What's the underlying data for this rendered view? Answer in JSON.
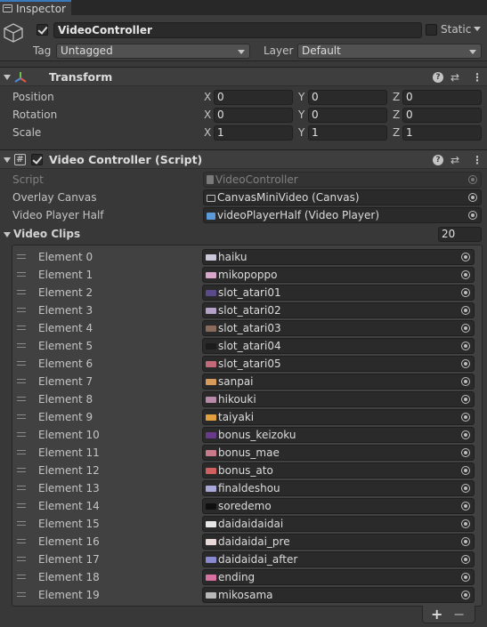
{
  "tab": {
    "label": "Inspector"
  },
  "gameobject": {
    "active": true,
    "name": "VideoController",
    "static_label": "Static",
    "tag_label": "Tag",
    "tag_value": "Untagged",
    "layer_label": "Layer",
    "layer_value": "Default"
  },
  "transform": {
    "title": "Transform",
    "rows": [
      {
        "label": "Position",
        "x": "0",
        "y": "0",
        "z": "0"
      },
      {
        "label": "Rotation",
        "x": "0",
        "y": "0",
        "z": "0"
      },
      {
        "label": "Scale",
        "x": "1",
        "y": "1",
        "z": "1"
      }
    ],
    "axis": {
      "x": "X",
      "y": "Y",
      "z": "Z"
    }
  },
  "script_component": {
    "title": "Video Controller (Script)",
    "script_label": "Script",
    "script_value": "VideoController",
    "overlay_label": "Overlay Canvas",
    "overlay_value": "CanvasMiniVideo (Canvas)",
    "player_label": "Video Player Half",
    "player_value": "videoPlayerHalf (Video Player)",
    "clips_label": "Video Clips",
    "clips_count": "20"
  },
  "clips": [
    {
      "label": "Element 0",
      "value": "haiku",
      "thumb": "#c9c9d9"
    },
    {
      "label": "Element 1",
      "value": "mikopoppo",
      "thumb": "#d7a6c9"
    },
    {
      "label": "Element 2",
      "value": "slot_atari01",
      "thumb": "#5a4a8a"
    },
    {
      "label": "Element 3",
      "value": "slot_atari02",
      "thumb": "#b4a2c6"
    },
    {
      "label": "Element 4",
      "value": "slot_atari03",
      "thumb": "#8a6a5a"
    },
    {
      "label": "Element 5",
      "value": "slot_atari04",
      "thumb": "#1c1c1c"
    },
    {
      "label": "Element 6",
      "value": "slot_atari05",
      "thumb": "#c06a7a"
    },
    {
      "label": "Element 7",
      "value": "sanpai",
      "thumb": "#d89a5a"
    },
    {
      "label": "Element 8",
      "value": "hikouki",
      "thumb": "#b88aa8"
    },
    {
      "label": "Element 9",
      "value": "taiyaki",
      "thumb": "#e0a040"
    },
    {
      "label": "Element 10",
      "value": "bonus_keizoku",
      "thumb": "#6a3a8a"
    },
    {
      "label": "Element 11",
      "value": "bonus_mae",
      "thumb": "#c87a8a"
    },
    {
      "label": "Element 12",
      "value": "bonus_ato",
      "thumb": "#d06060"
    },
    {
      "label": "Element 13",
      "value": "finaldeshou",
      "thumb": "#a8a8d8"
    },
    {
      "label": "Element 14",
      "value": "soredemo",
      "thumb": "#101010"
    },
    {
      "label": "Element 15",
      "value": "daidaidaidai",
      "thumb": "#e8e8e8"
    },
    {
      "label": "Element 16",
      "value": "daidaidai_pre",
      "thumb": "#e8d8d8"
    },
    {
      "label": "Element 17",
      "value": "daidaidai_after",
      "thumb": "#8a8ad0"
    },
    {
      "label": "Element 18",
      "value": "ending",
      "thumb": "#d870a0"
    },
    {
      "label": "Element 19",
      "value": "mikosama",
      "thumb": "#b8b8b8"
    }
  ],
  "footer": {
    "add": "+",
    "remove": "−"
  }
}
